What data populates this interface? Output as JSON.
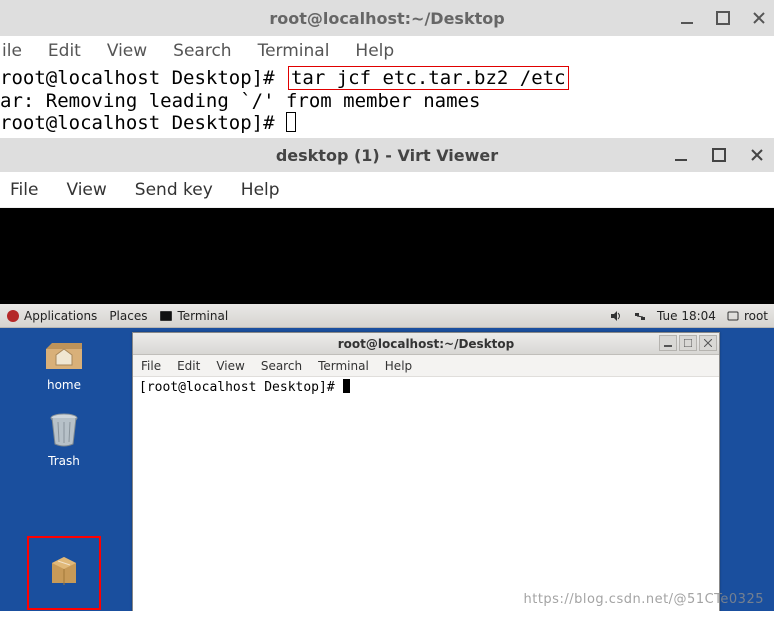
{
  "term1": {
    "title": "root@localhost:~/Desktop",
    "menu": {
      "file": "ile",
      "edit": "Edit",
      "view": "View",
      "search": "Search",
      "terminal": "Terminal",
      "help": "Help"
    },
    "lines": {
      "prompt1_pre": "root@localhost Desktop]# ",
      "highlighted_cmd": "tar jcf etc.tar.bz2 /etc",
      "line2": "ar: Removing leading `/' from member names",
      "prompt2": "root@localhost Desktop]# "
    }
  },
  "virt": {
    "title": "desktop (1) - Virt Viewer",
    "menu": {
      "file": "File",
      "view": "View",
      "sendkey": "Send key",
      "help": "Help"
    }
  },
  "guest": {
    "panel": {
      "applications": "Applications",
      "places": "Places",
      "terminal": "Terminal",
      "clock": "Tue 18:04",
      "user": "root"
    },
    "desktop_icons": {
      "home": "home",
      "trash": "Trash",
      "archive": ""
    },
    "term2": {
      "title": "root@localhost:~/Desktop",
      "menu": {
        "file": "File",
        "edit": "Edit",
        "view": "View",
        "search": "Search",
        "terminal": "Terminal",
        "help": "Help"
      },
      "prompt": "[root@localhost Desktop]# "
    }
  },
  "watermark": "https://blog.csdn.net/@51CTe0325"
}
